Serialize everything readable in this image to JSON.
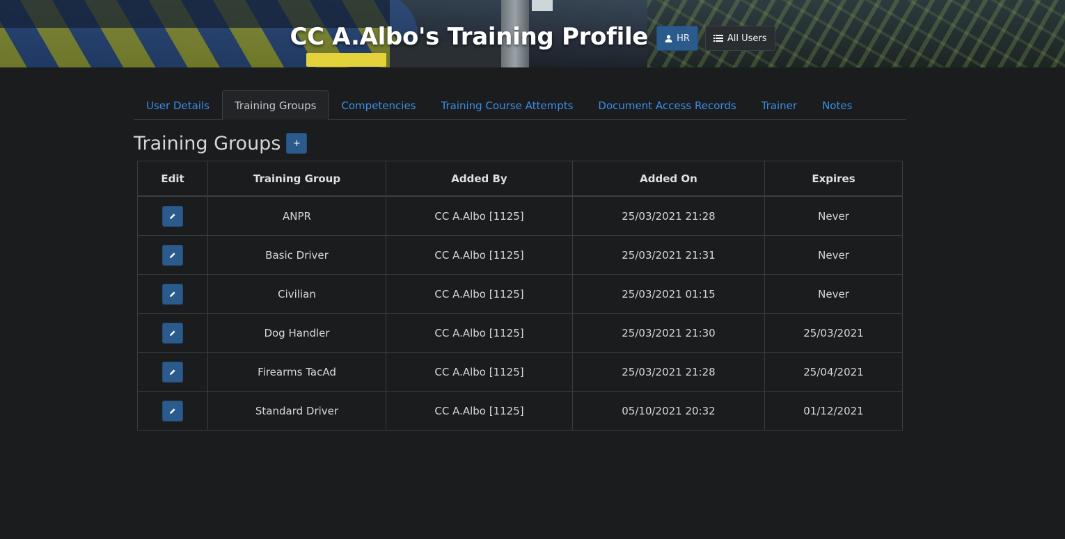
{
  "header": {
    "title": "CC A.Albo's Training Profile",
    "hr_label": "HR",
    "all_users_label": "All Users"
  },
  "tabs": [
    {
      "label": "User Details",
      "active": false
    },
    {
      "label": "Training Groups",
      "active": true
    },
    {
      "label": "Competencies",
      "active": false
    },
    {
      "label": "Training Course Attempts",
      "active": false
    },
    {
      "label": "Document Access Records",
      "active": false
    },
    {
      "label": "Trainer",
      "active": false
    },
    {
      "label": "Notes",
      "active": false
    }
  ],
  "section": {
    "title": "Training Groups",
    "add_label": "+"
  },
  "table": {
    "headers": [
      "Edit",
      "Training Group",
      "Added By",
      "Added On",
      "Expires"
    ],
    "rows": [
      {
        "group": "ANPR",
        "added_by": "CC A.Albo [1125]",
        "added_on": "25/03/2021 21:28",
        "expires": "Never"
      },
      {
        "group": "Basic Driver",
        "added_by": "CC A.Albo [1125]",
        "added_on": "25/03/2021 21:31",
        "expires": "Never"
      },
      {
        "group": "Civilian",
        "added_by": "CC A.Albo [1125]",
        "added_on": "25/03/2021 01:15",
        "expires": "Never"
      },
      {
        "group": "Dog Handler",
        "added_by": "CC A.Albo [1125]",
        "added_on": "25/03/2021 21:30",
        "expires": "25/03/2021"
      },
      {
        "group": "Firearms TacAd",
        "added_by": "CC A.Albo [1125]",
        "added_on": "25/03/2021 21:28",
        "expires": "25/04/2021"
      },
      {
        "group": "Standard Driver",
        "added_by": "CC A.Albo [1125]",
        "added_on": "05/10/2021 20:32",
        "expires": "01/12/2021"
      }
    ]
  },
  "colors": {
    "background": "#1b1c1e",
    "primary": "#2a5b8c",
    "link": "#3b8fe8",
    "border": "#3a3d41"
  },
  "icons": {
    "hr": "user-icon",
    "all_users": "list-icon",
    "edit": "pencil-icon"
  }
}
